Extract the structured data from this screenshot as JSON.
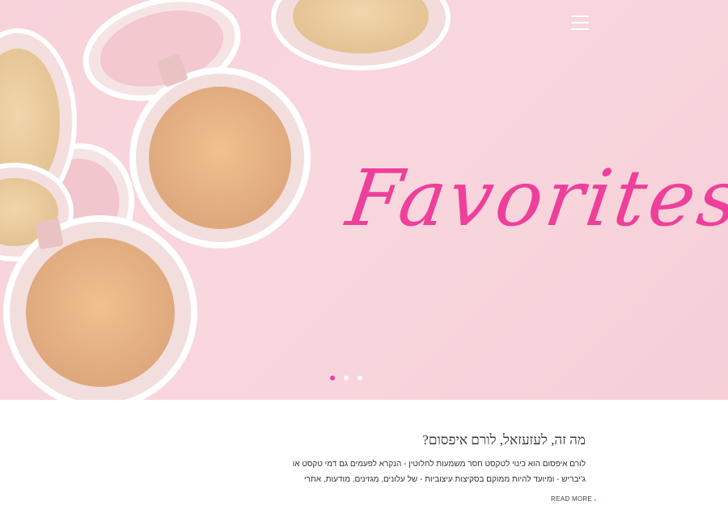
{
  "hero": {
    "title": "Favorites",
    "slides": 3,
    "active_slide": 1,
    "accent": "#ee3f9a",
    "background": "#f8d4db",
    "image": "makeup-compacts-photo"
  },
  "header": {
    "menu_icon": "hamburger-icon"
  },
  "article": {
    "heading": "מה זה, לעזעזאל, לורם איפסום?",
    "line1": "לורם איפסום הוא כינוי לטקסט חסר משמעות לחלוטין - הנקרא לפעמים גם דמי טקסט או",
    "line2": "ג'יבריש - ומיועד להיות ממוקם בסקיצות עיצוביות - של עלונים, מגזינים, מודעות, אתרי",
    "read_more": "READ MORE",
    "read_more_icon": "chevron-down-icon"
  }
}
